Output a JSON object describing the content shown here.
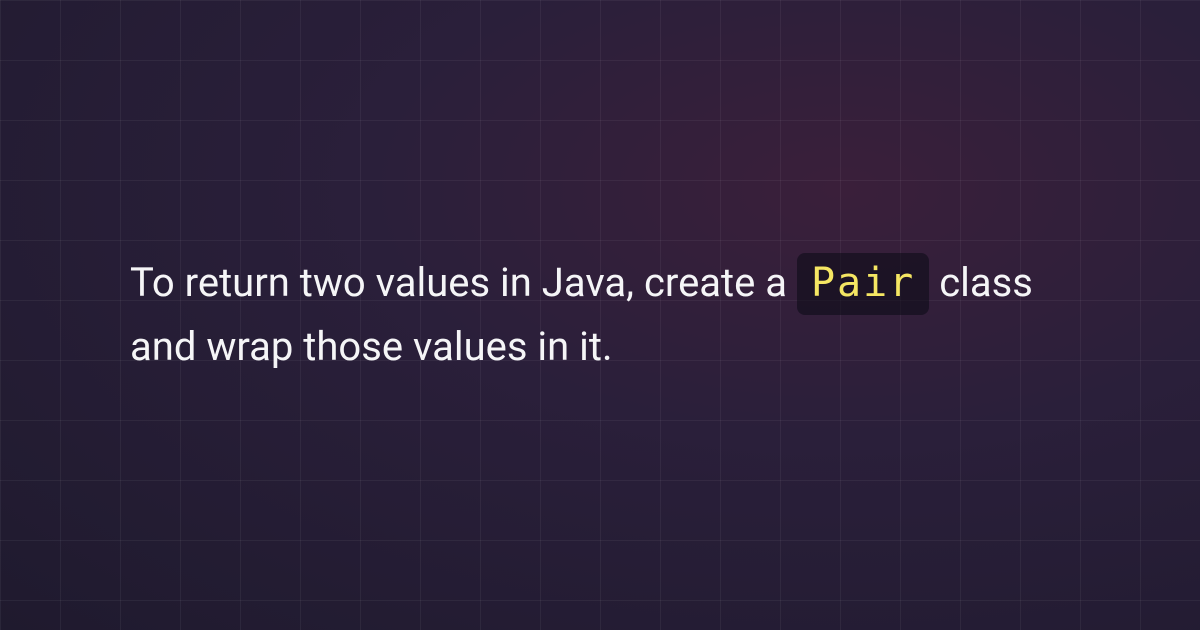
{
  "content": {
    "text_before_code": "To return two values in Java, create a ",
    "code_chip": "Pair",
    "text_after_code": " class and wrap those values in it."
  },
  "style": {
    "text_color": "#f5f5f7",
    "code_color": "#f5e663",
    "code_bg": "rgba(10,10,20,0.55)",
    "bg_gradient_start": "#3a1f3a",
    "bg_gradient_mid": "#2a1f3a",
    "bg_gradient_end": "#1f1a2e",
    "grid_color": "rgba(255,255,255,0.05)"
  }
}
